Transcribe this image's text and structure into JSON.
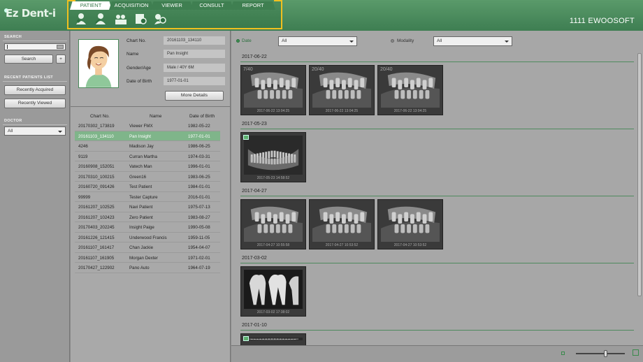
{
  "app": {
    "logo": "Ez Dent-i",
    "brand": "1111  EWOOSOFT"
  },
  "tabs": [
    {
      "label": "PATIENT",
      "active": true
    },
    {
      "label": "ACQUISITION",
      "active": false
    },
    {
      "label": "VIEWER",
      "active": false
    },
    {
      "label": "CONSULT",
      "active": false
    },
    {
      "label": "REPORT",
      "active": false
    }
  ],
  "toolbar_icons": [
    "add-patient-icon",
    "edit-patient-icon",
    "patient-group-icon",
    "import-icon",
    "search-patient-icon"
  ],
  "sidebar": {
    "search_title": "SEARCH",
    "search_value": "",
    "search_button": "Search",
    "plus_button": "+",
    "recent_title": "RECENT PATIENTS LIST",
    "recent_acquired": "Recently Acquired",
    "recent_viewed": "Recently Viewed",
    "doctor_title": "DOCTOR",
    "doctor_value": "All"
  },
  "patient": {
    "labels": {
      "chart_no": "Chart No.",
      "name": "Name",
      "gender_age": "Gender/Age",
      "dob": "Date of Birth"
    },
    "chart_no": "20161103_134110",
    "name": "Pan Insight",
    "gender_age": "Male / 40Y 6M",
    "dob": "1977-01-01",
    "more_details": "More Details"
  },
  "table": {
    "headers": {
      "chart_no": "Chart No.",
      "name": "Name",
      "dob": "Date of Birth"
    },
    "rows": [
      {
        "chart_no": "20170302_173819",
        "name": "Viewer FMX",
        "dob": "1982-05-22"
      },
      {
        "chart_no": "20161103_134110",
        "name": "Pan Insight",
        "dob": "1977-01-01",
        "selected": true
      },
      {
        "chart_no": "4246",
        "name": "Madison Jay",
        "dob": "1986-06-25"
      },
      {
        "chart_no": "9119",
        "name": "Curran Martha",
        "dob": "1974-03-31"
      },
      {
        "chart_no": "20160908_152051",
        "name": "Vatech Man",
        "dob": "1996-01-01"
      },
      {
        "chart_no": "20170310_100215",
        "name": " Green16",
        "dob": "1983-06-25"
      },
      {
        "chart_no": "20160720_091426",
        "name": "Test Patient",
        "dob": "1984-01-01"
      },
      {
        "chart_no": "99999",
        "name": "Tester Capture",
        "dob": "2016-01-01"
      },
      {
        "chart_no": "20161207_102525",
        "name": "Navi Patient",
        "dob": "1975-07-13"
      },
      {
        "chart_no": "20161207_102423",
        "name": "Zero Patient",
        "dob": "1983-08-27"
      },
      {
        "chart_no": "20170403_202245",
        "name": "Insight Paige",
        "dob": "1990-05-08"
      },
      {
        "chart_no": "20161226_121415",
        "name": "Underwood Francis",
        "dob": "1959-11-05"
      },
      {
        "chart_no": "20161107_161417",
        "name": "Chan Jackie",
        "dob": "1954-04-07"
      },
      {
        "chart_no": "20161107_161905",
        "name": "Morgan Dexter",
        "dob": "1971-02-01"
      },
      {
        "chart_no": "20170427_122902",
        "name": "Pano Auto",
        "dob": "1964-07-19"
      }
    ]
  },
  "filters": {
    "date_label": "Date",
    "date_value": "All",
    "modality_label": "Modality",
    "modality_value": "All",
    "active_color": "#3f8f52"
  },
  "image_groups": [
    {
      "date": "2017-06-22",
      "images": [
        {
          "badge": "7/40",
          "caption": "2017-06-22 13:04:25",
          "kind": "ceph"
        },
        {
          "badge": "20/40",
          "caption": "2017-06-22 13:04:25",
          "kind": "ceph"
        },
        {
          "badge": "20/40",
          "caption": "2017-06-22 13:04:25",
          "kind": "ceph"
        }
      ]
    },
    {
      "date": "2017-05-23",
      "images": [
        {
          "badge": "",
          "caption": "2017-05-23 14:58:52",
          "kind": "pano",
          "folder": true
        }
      ]
    },
    {
      "date": "2017-04-27",
      "images": [
        {
          "badge": "",
          "caption": "2017-04-27 10:55:58",
          "kind": "ceph"
        },
        {
          "badge": "",
          "caption": "2017-04-27 10:53:52",
          "kind": "ceph"
        },
        {
          "badge": "",
          "caption": "2017-04-27 10:53:52",
          "kind": "ceph"
        }
      ]
    },
    {
      "date": "2017-03-02",
      "images": [
        {
          "badge": "",
          "caption": "2017-03-02 17:38:02",
          "kind": "intraoral"
        }
      ]
    },
    {
      "date": "2017-01-10",
      "images": [
        {
          "badge": "",
          "caption": "",
          "kind": "pano",
          "folder": true
        }
      ]
    }
  ]
}
